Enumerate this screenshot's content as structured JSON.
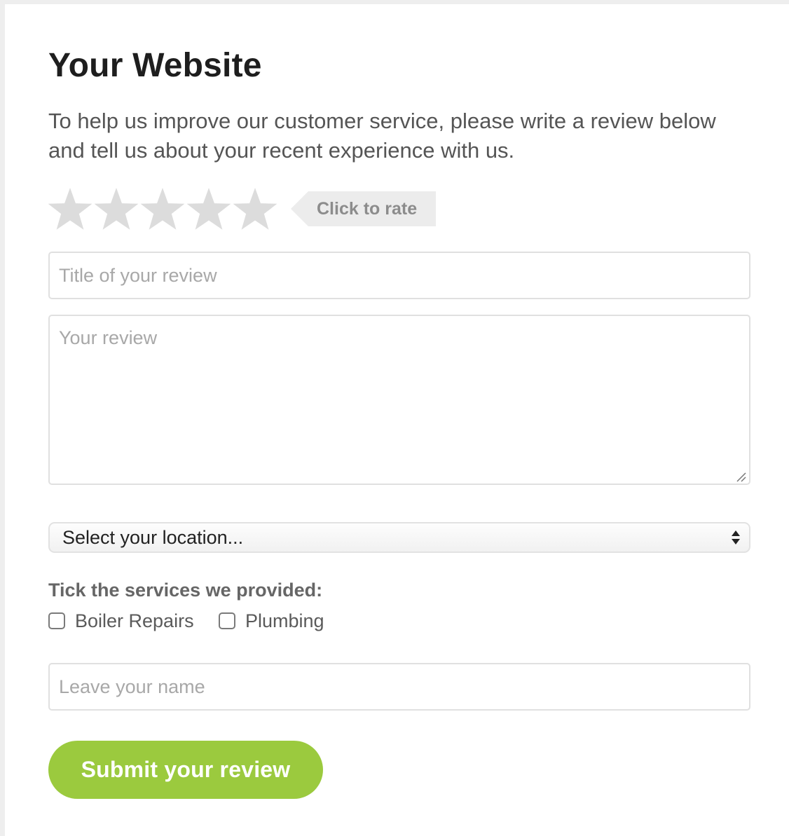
{
  "form": {
    "title": "Your Website",
    "intro": "To help us improve our customer service, please write a review below and tell us about your recent experience with us.",
    "rating": {
      "stars_total": 5,
      "stars_selected": 0,
      "prompt": "Click to rate",
      "star_color": "#dcdcdc",
      "tag_color": "#ececec"
    },
    "review_title": {
      "placeholder": "Title of your review",
      "value": ""
    },
    "review_body": {
      "placeholder": "Your review",
      "value": ""
    },
    "location": {
      "selected": "Select your location..."
    },
    "services": {
      "label": "Tick the services we provided:",
      "options": [
        {
          "label": "Boiler Repairs",
          "checked": false
        },
        {
          "label": "Plumbing",
          "checked": false
        }
      ]
    },
    "name": {
      "placeholder": "Leave your name",
      "value": ""
    },
    "submit_label": "Submit your review",
    "accent_color": "#9bca3e"
  }
}
